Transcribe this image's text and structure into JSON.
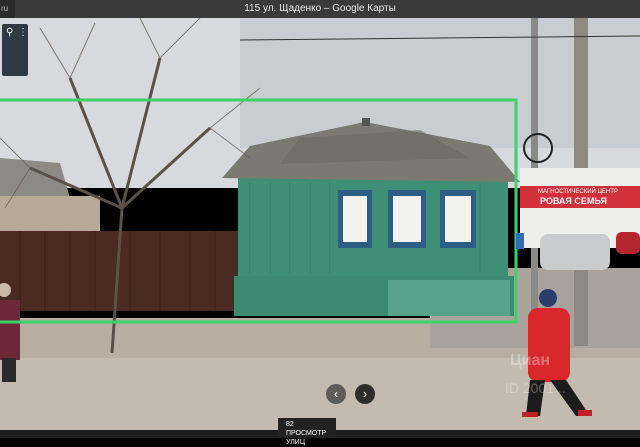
{
  "window": {
    "title": "115 ул. Щаденко – Google Карты",
    "corner_text": "ru"
  },
  "minimap": {
    "pin_icon": "map-pin-icon",
    "menu_icon": "more-vert-icon"
  },
  "navigation": {
    "prev_symbol": "‹",
    "next_symbol": "›"
  },
  "street_view_label": {
    "number": "82",
    "text": "ПРОСМОТР УЛИЦ"
  },
  "store_sign": {
    "line1": "МАГНОСТИЧЕСКИЙ ЦЕНТР",
    "line2": "РОВАЯ СЕМЬЯ"
  },
  "watermark": {
    "brand": "Циан",
    "id": "ID 2001..."
  },
  "colors": {
    "highlight_frame": "#3cd26a",
    "house_wall": "#3f8f77",
    "roof": "#7a7a72",
    "sign_red": "#d2303b"
  }
}
